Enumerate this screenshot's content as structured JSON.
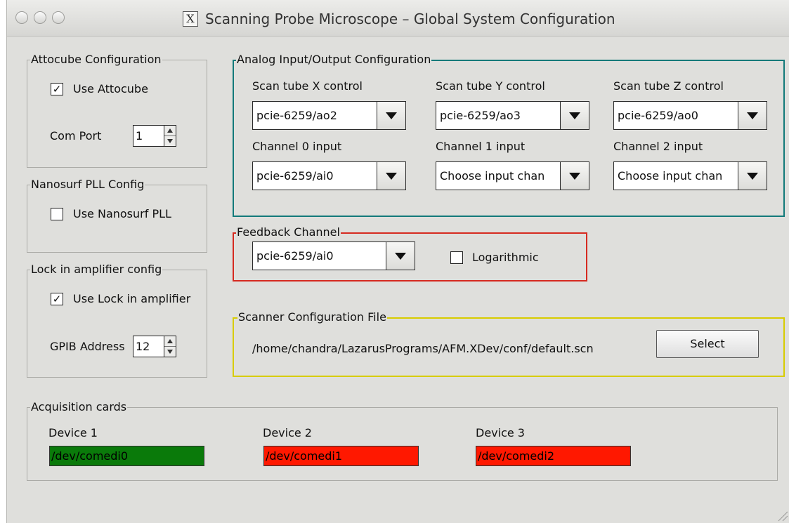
{
  "window": {
    "title": "Scanning Probe Microscope – Global System Configuration",
    "title_icon_glyph": "X"
  },
  "attocube": {
    "legend": "Attocube Configuration",
    "use_attocube_label": "Use Attocube",
    "use_attocube_checked": true,
    "com_port_label": "Com Port",
    "com_port_value": "1"
  },
  "nanosurf": {
    "legend": "Nanosurf PLL Config",
    "use_pll_label": "Use Nanosurf PLL",
    "use_pll_checked": false
  },
  "lockin": {
    "legend": "Lock in amplifier config",
    "use_lockin_label": "Use Lock in amplifier",
    "use_lockin_checked": true,
    "gpib_label": "GPIB Address",
    "gpib_value": "12"
  },
  "analog": {
    "legend": "Analog Input/Output Configuration",
    "x_label": "Scan tube X  control",
    "x_value": "pcie-6259/ao2",
    "y_label": "Scan tube Y control",
    "y_value": "pcie-6259/ao3",
    "z_label": "Scan tube Z control",
    "z_value": "pcie-6259/ao0",
    "ch0_label": "Channel 0 input",
    "ch0_value": "pcie-6259/ai0",
    "ch1_label": "Channel 1 input",
    "ch1_value": "Choose input chan",
    "ch2_label": "Channel 2 input",
    "ch2_value": "Choose input chan"
  },
  "feedback": {
    "legend": "Feedback Channel",
    "value": "pcie-6259/ai0",
    "log_label": "Logarithmic",
    "log_checked": false
  },
  "scanner": {
    "legend": "Scanner Configuration File",
    "path": "/home/chandra/LazarusPrograms/AFM.XDev/conf/default.scn",
    "select_label": "Select"
  },
  "acquisition": {
    "legend": "Acquisition cards",
    "devices": [
      {
        "label": "Device 1",
        "value": "/dev/comedi0",
        "color": "#0a7a0a"
      },
      {
        "label": "Device 2",
        "value": "/dev/comedi1",
        "color": "#ff1800"
      },
      {
        "label": "Device 3",
        "value": "/dev/comedi2",
        "color": "#ff1800"
      }
    ]
  },
  "colors": {
    "analog_border": "#127a7a",
    "feedback_border": "#d62a20",
    "scanner_border": "#d8cc00"
  }
}
